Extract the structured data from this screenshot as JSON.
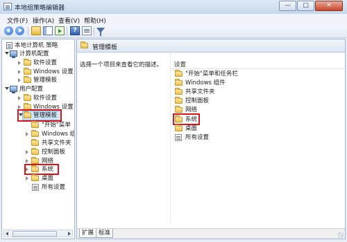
{
  "window": {
    "title": "本地组策略编辑器",
    "controls": {
      "minimize": "—",
      "maximize": "□",
      "close": "✕"
    }
  },
  "menu": [
    "文件(F)",
    "操作(A)",
    "查看(V)",
    "帮助(H)"
  ],
  "toolbar": {
    "icons": [
      "back-arrow-icon",
      "forward-arrow-icon",
      "up-folder-icon",
      "show-hide-tree-icon",
      "export-list-icon",
      "help-icon",
      "properties-icon",
      "filter-icon"
    ]
  },
  "tree": {
    "root": "本地计算机 策略",
    "computer_config": "计算机配置",
    "computer_children": [
      "软件设置",
      "Windows 设置",
      "管理模板"
    ],
    "user_config": "用户配置",
    "user_children": [
      "软件设置",
      "Windows 设置",
      "管理模板"
    ],
    "admin_children": [
      "\"开始\"菜单",
      "Windows 组",
      "共享文件夹",
      "控制面板",
      "网络",
      "系统",
      "桌面",
      "所有设置"
    ]
  },
  "content": {
    "header_title": "管理模板",
    "description": "选择一个项目来查看它的描述。",
    "column_header": "设置",
    "items": [
      "\"开始\"菜单和任务栏",
      "Windows 组件",
      "共享文件夹",
      "控制面板",
      "网络",
      "系统",
      "桌面",
      "所有设置"
    ]
  },
  "tabs": [
    "扩展",
    "标准"
  ],
  "highlight_color": "#d8141c"
}
